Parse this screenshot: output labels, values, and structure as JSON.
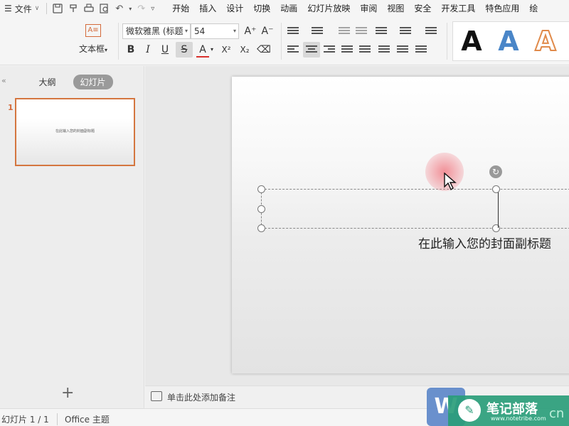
{
  "menubar": {
    "file_label": "文件",
    "tabs": [
      "开始",
      "插入",
      "设计",
      "切换",
      "动画",
      "幻灯片放映",
      "审阅",
      "视图",
      "安全",
      "开发工具",
      "特色应用",
      "绘"
    ]
  },
  "ribbon": {
    "textbox_label": "文本框",
    "font_name": "微软雅黑 (标题",
    "font_size": "54",
    "bold": "B",
    "italic": "I",
    "underline": "U",
    "strike": "S",
    "font_color": "A",
    "superscript": "X²",
    "subscript": "X₂",
    "grow": "A⁺",
    "shrink": "A⁻",
    "art_styles": [
      "A",
      "A",
      "A"
    ],
    "colors": {
      "accent": "#d46a3a",
      "art_black": "#111111",
      "art_blue": "#4a86c8",
      "art_orange": "#e08a4a"
    }
  },
  "left_panel": {
    "tab_outline": "大纲",
    "tab_slides": "幻灯片",
    "slide_number": "1",
    "thumb_text": "在此输入您的封面副标题",
    "add_icon": "+"
  },
  "slide": {
    "subtitle": "在此输入您的封面副标题"
  },
  "notes": {
    "placeholder": "单击此处添加备注"
  },
  "status": {
    "slide_info": "幻灯片 1 / 1",
    "theme": "Office 主题"
  },
  "watermark": {
    "title": "笔记部落",
    "url": "www.notetribe.com",
    "suffix": "cn"
  }
}
